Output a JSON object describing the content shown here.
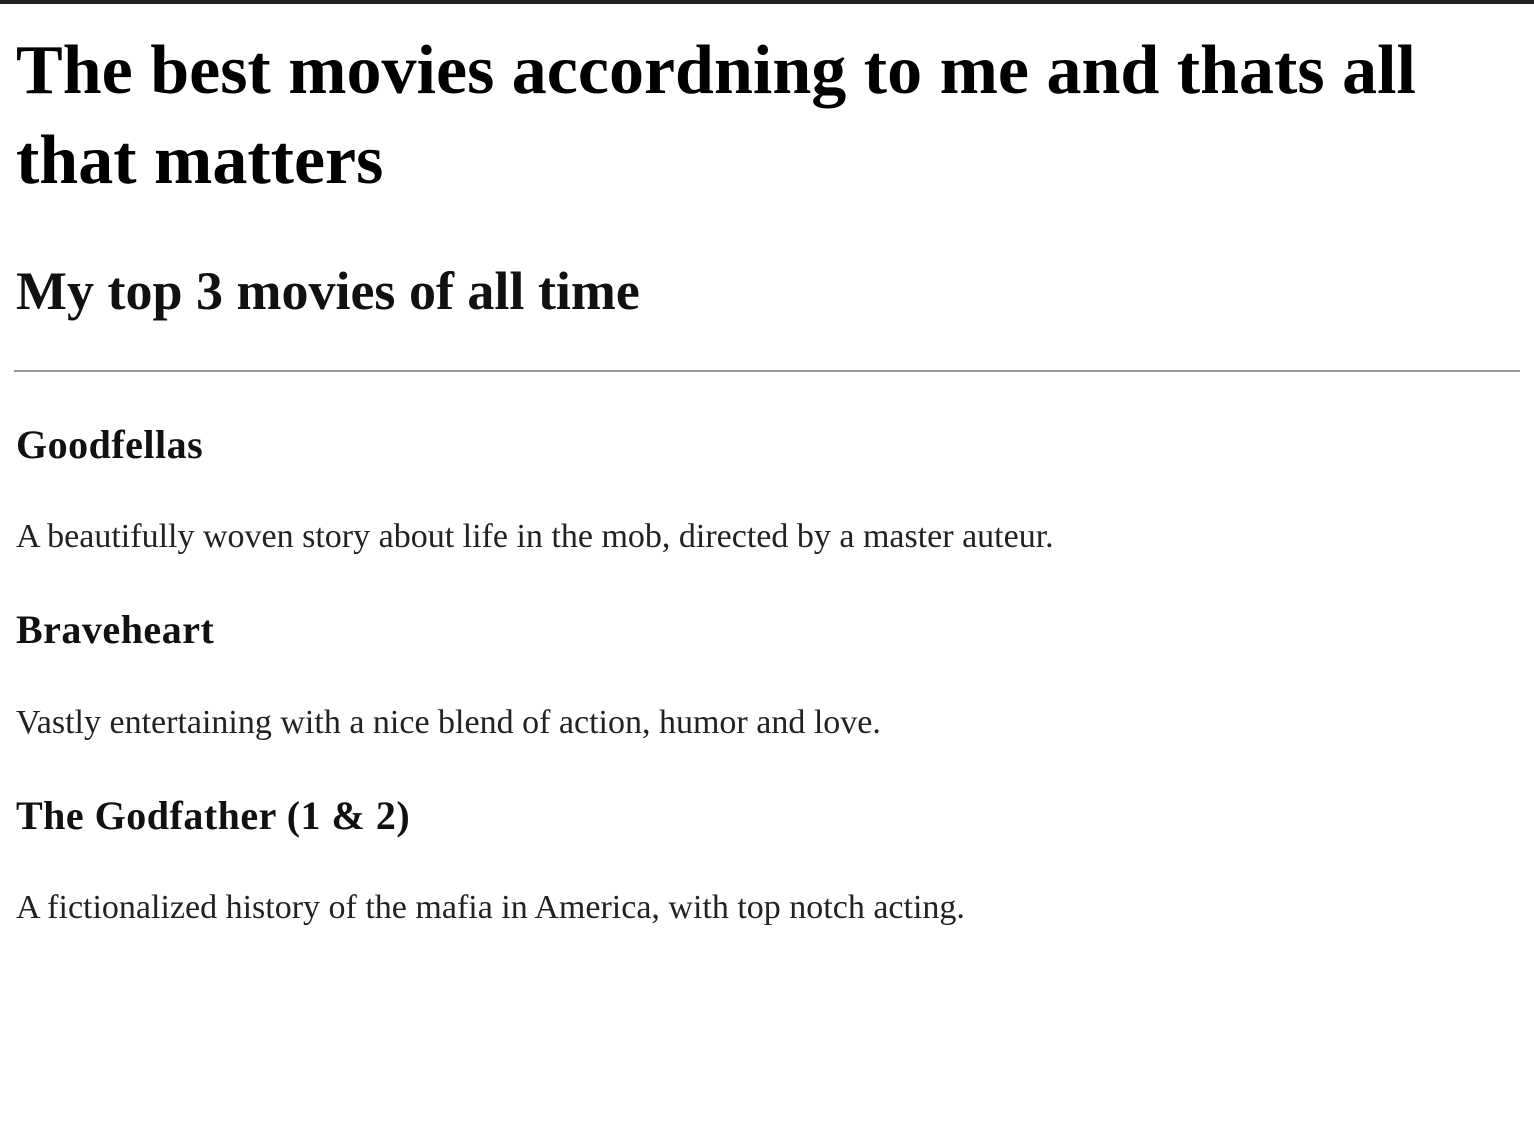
{
  "page": {
    "title": "The best movies accordning to me and thats all that matters",
    "subtitle": "My top 3 movies of all time"
  },
  "movies": [
    {
      "title": "Goodfellas",
      "description": "A beautifully woven story about life in the mob, directed by a master auteur."
    },
    {
      "title": "Braveheart",
      "description": "Vastly entertaining with a nice blend of action, humor and love."
    },
    {
      "title": "The Godfather (1 & 2)",
      "description": "A fictionalized history of the mafia in America, with top notch acting."
    }
  ],
  "colors": {
    "top_border": "#222222",
    "text": "#111111",
    "divider": "#9a9a9a",
    "background": "#ffffff"
  }
}
